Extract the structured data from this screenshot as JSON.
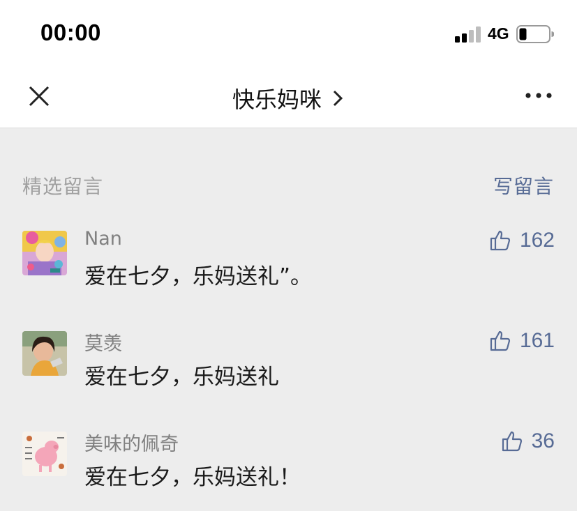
{
  "status_bar": {
    "time": "00:00",
    "network": "4G"
  },
  "nav": {
    "title": "快乐妈咪",
    "close_icon": "close-icon",
    "more_icon": "more-icon",
    "chevron_icon": "chevron-right-icon"
  },
  "section": {
    "title": "精选留言",
    "write_label": "写留言"
  },
  "comments": [
    {
      "nickname": "Nan",
      "text": "爱在七夕，乐妈送礼”。",
      "likes": "162"
    },
    {
      "nickname": "莫羡",
      "text": "爱在七夕，乐妈送礼",
      "likes": "161"
    },
    {
      "nickname": "美味的佩奇",
      "text": "爱在七夕，乐妈送礼！",
      "likes": "36"
    }
  ],
  "colors": {
    "link": "#576b95",
    "muted": "#a1a1a1",
    "background": "#ededed"
  }
}
